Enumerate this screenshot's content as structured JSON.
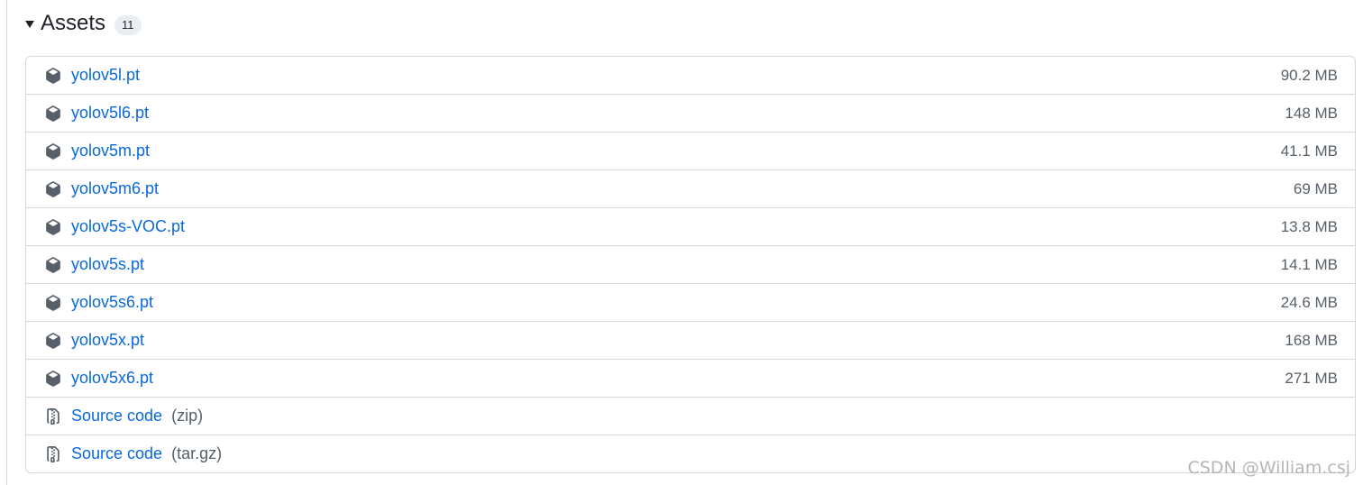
{
  "assets": {
    "title": "Assets",
    "count": "11",
    "items": [
      {
        "name": "yolov5l.pt",
        "size": "90.2 MB",
        "icon": "package-icon"
      },
      {
        "name": "yolov5l6.pt",
        "size": "148 MB",
        "icon": "package-icon"
      },
      {
        "name": "yolov5m.pt",
        "size": "41.1 MB",
        "icon": "package-icon"
      },
      {
        "name": "yolov5m6.pt",
        "size": "69 MB",
        "icon": "package-icon"
      },
      {
        "name": "yolov5s-VOC.pt",
        "size": "13.8 MB",
        "icon": "package-icon"
      },
      {
        "name": "yolov5s.pt",
        "size": "14.1 MB",
        "icon": "package-icon"
      },
      {
        "name": "yolov5s6.pt",
        "size": "24.6 MB",
        "icon": "package-icon"
      },
      {
        "name": "yolov5x.pt",
        "size": "168 MB",
        "icon": "package-icon"
      },
      {
        "name": "yolov5x6.pt",
        "size": "271 MB",
        "icon": "package-icon"
      }
    ],
    "source": [
      {
        "name": "Source code",
        "ext": "(zip)",
        "icon": "file-zip-icon"
      },
      {
        "name": "Source code",
        "ext": "(tar.gz)",
        "icon": "file-zip-icon"
      }
    ]
  },
  "watermark": "CSDN @William.csj",
  "colors": {
    "link": "#0969da",
    "muted": "#57606a",
    "border": "#d0d7de"
  }
}
